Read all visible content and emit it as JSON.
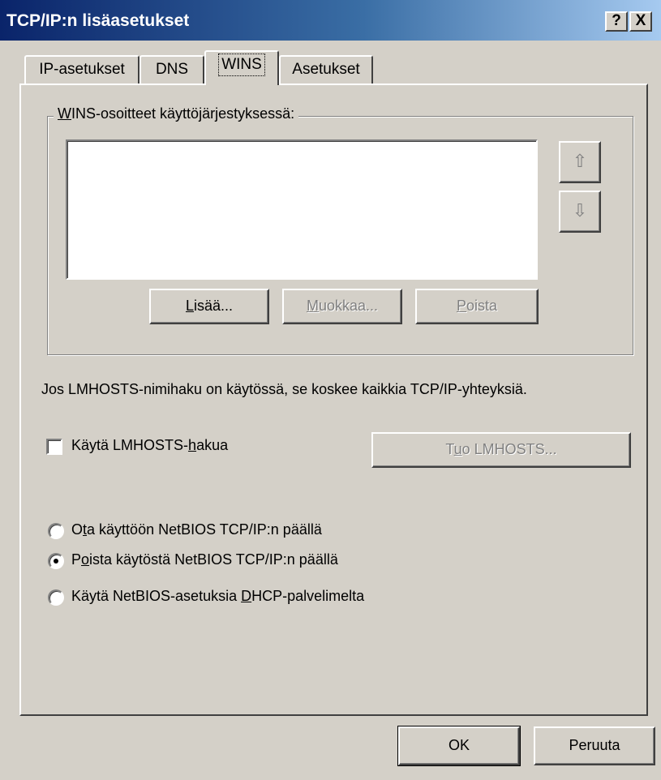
{
  "window": {
    "title": "TCP/IP:n lisäasetukset",
    "help_button": "?",
    "close_button": "X"
  },
  "tabs": [
    {
      "label": "IP-asetukset",
      "active": false
    },
    {
      "label": "DNS",
      "active": false
    },
    {
      "label": "WINS",
      "active": true
    },
    {
      "label": "Asetukset",
      "active": false
    }
  ],
  "wins_group": {
    "label_accel": "W",
    "label_rest": "INS-osoitteet käyttöjärjestyksessä:",
    "list_items": [],
    "up_icon": "⇧",
    "down_icon": "⇩",
    "add_accel": "L",
    "add_rest": "isää...",
    "edit_accel": "M",
    "edit_rest": "uokkaa...",
    "remove_accel": "P",
    "remove_rest": "oista"
  },
  "lmhosts": {
    "info_text": "Jos LMHOSTS-nimihaku on käytössä, se koskee kaikkia TCP/IP-yhteyksiä.",
    "checkbox_pre": "Käytä LMHOSTS-",
    "checkbox_accel": "h",
    "checkbox_post": "akua",
    "checked": false,
    "import_pre": "T",
    "import_accel": "u",
    "import_post": "o LMHOSTS..."
  },
  "netbios": {
    "options": [
      {
        "pre": "O",
        "accel": "t",
        "post": "a käyttöön NetBIOS TCP/IP:n päällä",
        "selected": false
      },
      {
        "pre": "P",
        "accel": "o",
        "post": "ista käytöstä NetBIOS TCP/IP:n päällä",
        "selected": true
      },
      {
        "pre": "Käytä NetBIOS-asetuksia ",
        "accel": "D",
        "post": "HCP-palvelimelta",
        "selected": false
      }
    ]
  },
  "footer": {
    "ok_label": "OK",
    "cancel_label": "Peruuta"
  }
}
